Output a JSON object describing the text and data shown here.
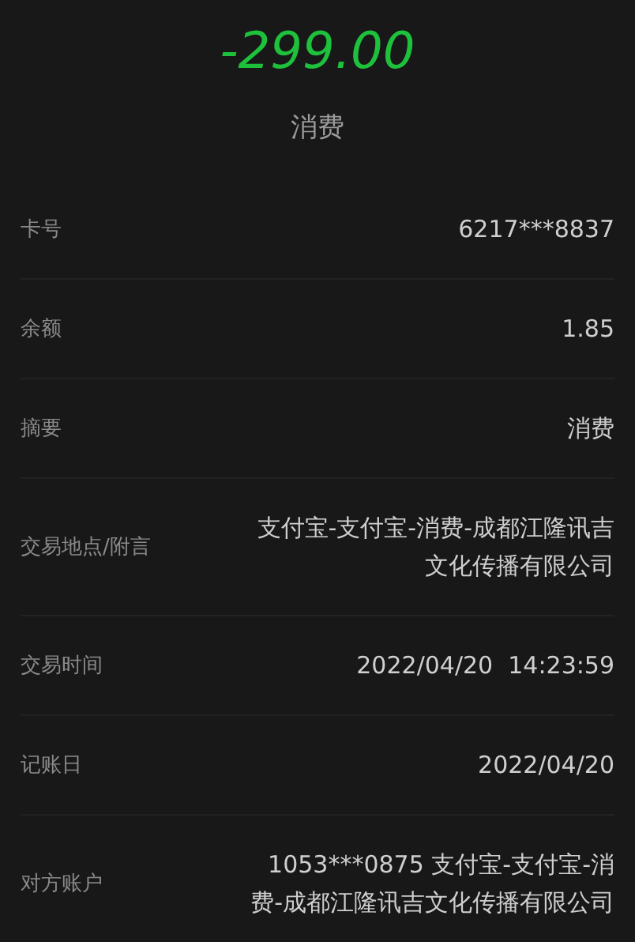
{
  "amount": "-299.00",
  "type": "消费",
  "details": [
    {
      "label": "卡号",
      "value": "6217***8837"
    },
    {
      "label": "余额",
      "value": "1.85"
    },
    {
      "label": "摘要",
      "value": "消费"
    },
    {
      "label": "交易地点/附言",
      "value": "支付宝-支付宝-消费-成都江隆讯吉文化传播有限公司"
    },
    {
      "label": "交易时间",
      "value": "2022/04/20  14:23:59"
    },
    {
      "label": "记账日",
      "value": "2022/04/20"
    },
    {
      "label": "对方账户",
      "value": "1053***0875 支付宝-支付宝-消费-成都江隆讯吉文化传播有限公司"
    }
  ]
}
